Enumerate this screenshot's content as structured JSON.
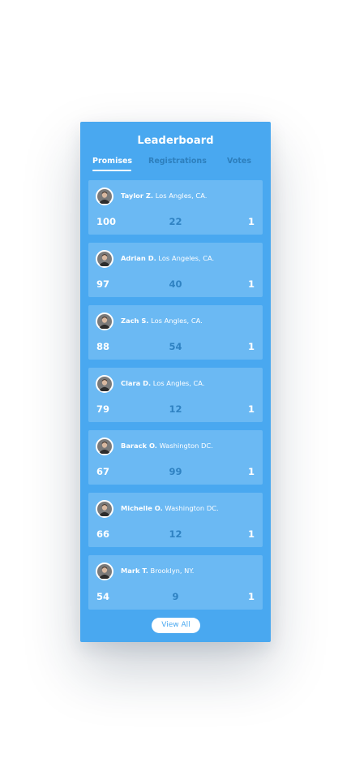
{
  "leaderboard": {
    "title": "Leaderboard",
    "tabs": [
      {
        "label": "Promises",
        "active": true
      },
      {
        "label": "Registrations",
        "active": false
      },
      {
        "label": "Votes",
        "active": false
      }
    ],
    "entries": [
      {
        "name": "Taylor Z.",
        "location": "Los Angles, CA.",
        "promises": "100",
        "registrations": "22",
        "votes": "1"
      },
      {
        "name": "Adrian D.",
        "location": "Los Angeles, CA.",
        "promises": "97",
        "registrations": "40",
        "votes": "1"
      },
      {
        "name": "Zach S.",
        "location": "Los Angles, CA.",
        "promises": "88",
        "registrations": "54",
        "votes": "1"
      },
      {
        "name": "Clara D.",
        "location": "Los Angles, CA.",
        "promises": "79",
        "registrations": "12",
        "votes": "1"
      },
      {
        "name": "Barack O.",
        "location": "Washington DC.",
        "promises": "67",
        "registrations": "99",
        "votes": "1"
      },
      {
        "name": "Michelle O.",
        "location": "Washington DC.",
        "promises": "66",
        "registrations": "12",
        "votes": "1"
      },
      {
        "name": "Mark T.",
        "location": "Brooklyn, NY.",
        "promises": "54",
        "registrations": "9",
        "votes": "1"
      }
    ],
    "view_all_label": "View All"
  },
  "colors": {
    "card": "#49a8f0",
    "entry": "#6bb9f3",
    "muted": "#2f82c2",
    "text": "#ffffff"
  },
  "icons": {
    "avatar": "user-avatar-icon"
  }
}
